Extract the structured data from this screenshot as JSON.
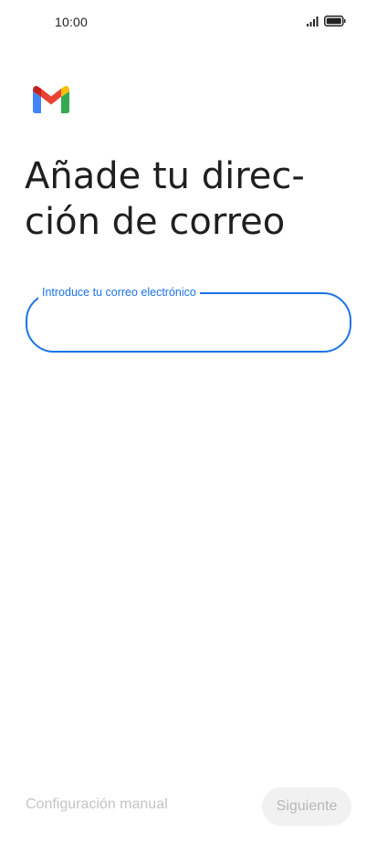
{
  "status_bar": {
    "time": "10:00",
    "icons": [
      "signal-icon",
      "battery-icon"
    ]
  },
  "brand": {
    "logo": "gmail-logo",
    "colors": {
      "red": "#ea4335",
      "blue": "#4285f4",
      "green": "#34a853",
      "yellow": "#fbbc04",
      "dark_red": "#c5221f"
    }
  },
  "main": {
    "title": "Añade tu direc-ción de correo",
    "email_field": {
      "label": "Introduce tu correo electrónico",
      "value": "",
      "accent_color": "#1a73e8"
    }
  },
  "footer": {
    "manual_setup_label": "Configuración manual",
    "next_label": "Siguiente"
  }
}
